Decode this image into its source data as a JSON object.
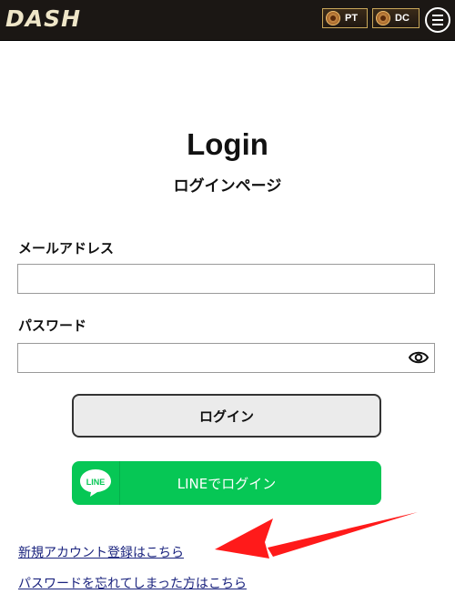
{
  "header": {
    "logo": "DASH",
    "wallets": [
      {
        "code": "PT"
      },
      {
        "code": "DC"
      }
    ],
    "menu_icon": "hamburger-icon"
  },
  "page": {
    "title": "Login",
    "subtitle": "ログインページ"
  },
  "form": {
    "email_label": "メールアドレス",
    "email_value": "",
    "password_label": "パスワード",
    "password_value": "",
    "password_toggle_icon": "eye-icon",
    "login_button": "ログイン",
    "line_button": "LINEでログイン",
    "line_icon_text": "LINE"
  },
  "links": {
    "register": "新規アカウント登録はこちら",
    "forgot_password": "パスワードを忘れてしまった方はこちら"
  },
  "colors": {
    "header_bg": "#1b1714",
    "line_green": "#06c755",
    "annotation_arrow": "#ff1a1a",
    "link": "#1a237e"
  }
}
